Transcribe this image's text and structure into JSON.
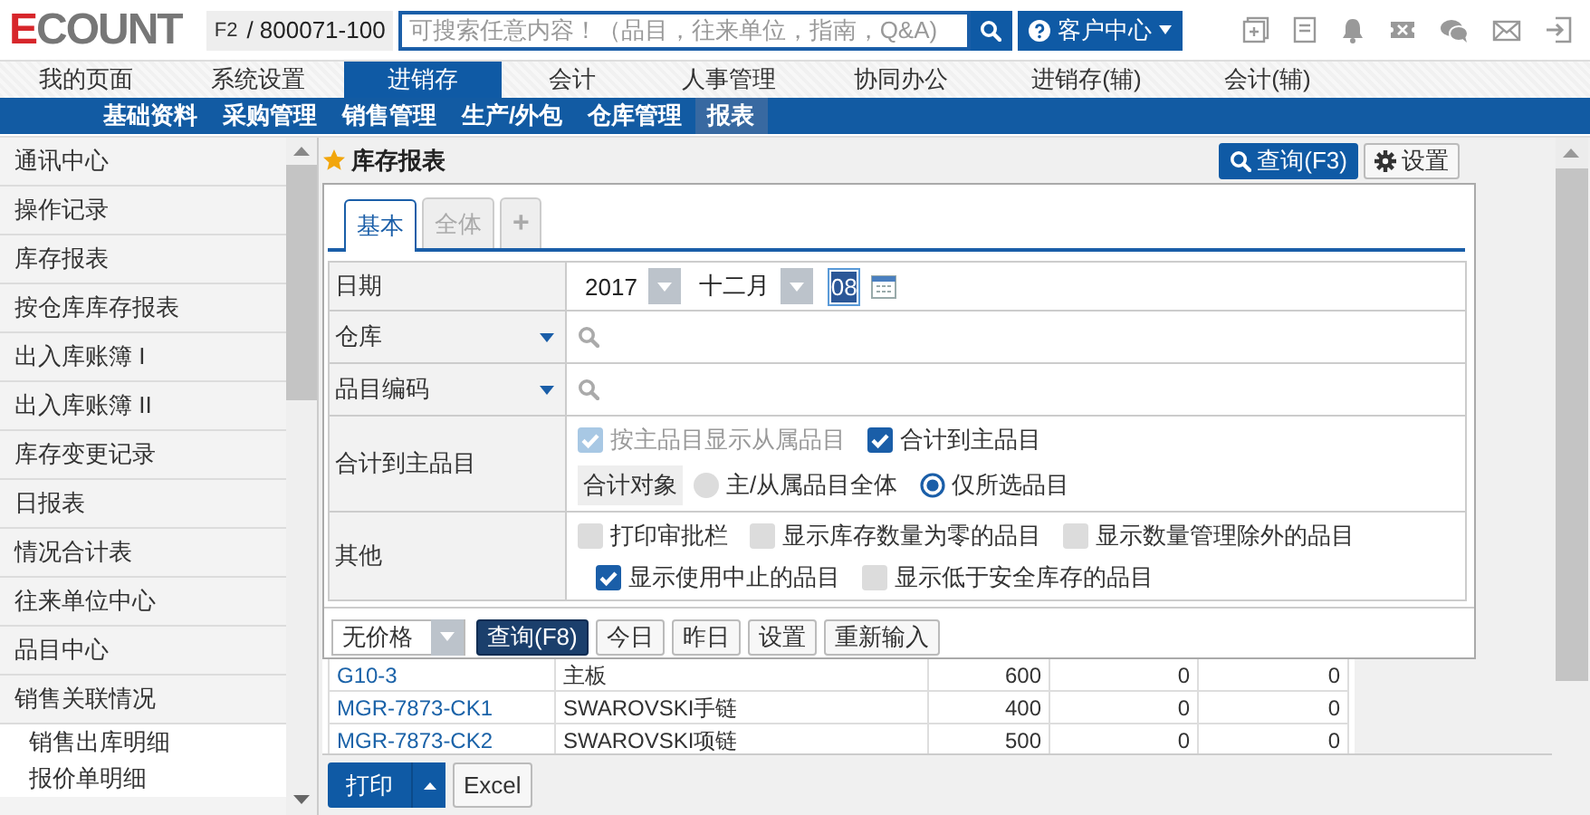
{
  "header": {
    "logo": "ECOUNT",
    "shortcut": "F2",
    "company_code": "/ 800071-100",
    "search": {
      "placeholder": "可搜索任意内容！（品目，往来单位，指南，Q&A)"
    },
    "help_menu": "客户中心"
  },
  "main_nav": [
    {
      "label": "我的页面",
      "selected": false
    },
    {
      "label": "系统设置",
      "selected": false
    },
    {
      "label": "进销存",
      "selected": true
    },
    {
      "label": "会计",
      "selected": false
    },
    {
      "label": "人事管理",
      "selected": false
    },
    {
      "label": "协同办公",
      "selected": false
    },
    {
      "label": "进销存(辅)",
      "selected": false
    },
    {
      "label": "会计(辅)",
      "selected": false
    }
  ],
  "sub_nav": [
    {
      "label": "基础资料",
      "selected": false
    },
    {
      "label": "采购管理",
      "selected": false
    },
    {
      "label": "销售管理",
      "selected": false
    },
    {
      "label": "生产/外包",
      "selected": false
    },
    {
      "label": "仓库管理",
      "selected": false
    },
    {
      "label": "报表",
      "selected": true
    }
  ],
  "sidebar": {
    "items": [
      {
        "label": "通讯中心"
      },
      {
        "label": "操作记录"
      },
      {
        "label": "库存报表"
      },
      {
        "label": "按仓库库存报表"
      },
      {
        "label": "出入库账簿 I"
      },
      {
        "label": "出入库账簿 II"
      },
      {
        "label": "库存变更记录"
      },
      {
        "label": "日报表"
      },
      {
        "label": "情况合计表"
      },
      {
        "label": "往来单位中心"
      },
      {
        "label": "品目中心"
      },
      {
        "label": "销售关联情况",
        "children": [
          {
            "label": "销售出库明细"
          },
          {
            "label": "报价单明细"
          }
        ]
      }
    ]
  },
  "report": {
    "title": "库存报表",
    "actions": [
      {
        "label": "查询(F3)",
        "kind": "primary"
      },
      {
        "label": "设置",
        "kind": "settings"
      }
    ],
    "tabs": [
      {
        "label": "基本",
        "selected": true
      },
      {
        "label": "全体",
        "selected": false
      },
      {
        "label": "+",
        "selected": false
      }
    ],
    "form": [
      {
        "label": "日期",
        "kind": "date",
        "year": "2017",
        "month": "十二月",
        "day": "08"
      },
      {
        "label": "仓库",
        "kind": "lookup"
      },
      {
        "label": "品目编码",
        "kind": "lookup"
      },
      {
        "label": "合计到主品目",
        "kind": "options",
        "lines": [
          [
            {
              "kind": "checkbox",
              "label": "按主品目显示从属品目",
              "checked": true,
              "disabled": true
            },
            {
              "kind": "checkbox",
              "label": "合计到主品目",
              "checked": true,
              "disabled": false
            }
          ],
          [
            {
              "kind": "tag",
              "label": "合计对象"
            },
            {
              "kind": "radio",
              "label": "主/从属品目全体",
              "selected": false
            },
            {
              "kind": "radio",
              "label": "仅所选品目",
              "selected": true
            }
          ]
        ]
      },
      {
        "label": "其他",
        "kind": "options",
        "lines": [
          [
            {
              "kind": "checkbox",
              "label": "打印审批栏",
              "checked": false,
              "disabled": false
            },
            {
              "kind": "checkbox",
              "label": "显示库存数量为零的品目",
              "checked": false,
              "disabled": false
            },
            {
              "kind": "checkbox",
              "label": "显示数量管理除外的品目",
              "checked": false,
              "disabled": false
            }
          ],
          [
            {
              "kind": "checkbox",
              "label": "显示使用中止的品目",
              "checked": true,
              "disabled": false
            },
            {
              "kind": "checkbox",
              "label": "显示低于安全库存的品目",
              "checked": false,
              "disabled": false
            }
          ]
        ]
      }
    ],
    "toolbar": {
      "price_select": "无价格",
      "buttons": [
        {
          "label": "查询(F8)",
          "kind": "primary"
        },
        {
          "label": "今日",
          "kind": "default"
        },
        {
          "label": "昨日",
          "kind": "default"
        },
        {
          "label": "设置",
          "kind": "default"
        },
        {
          "label": "重新输入",
          "kind": "default"
        }
      ]
    },
    "table": {
      "rows": [
        [
          "G10-3",
          "主板",
          "600",
          "0",
          "0"
        ],
        [
          "MGR-7873-CK1",
          "SWAROVSKI手链",
          "400",
          "0",
          "0"
        ],
        [
          "MGR-7873-CK2",
          "SWAROVSKI项链",
          "500",
          "0",
          "0"
        ]
      ]
    },
    "footer": {
      "buttons": [
        {
          "label": "打印",
          "kind": "split"
        },
        {
          "label": "Excel",
          "kind": "default"
        }
      ]
    }
  }
}
